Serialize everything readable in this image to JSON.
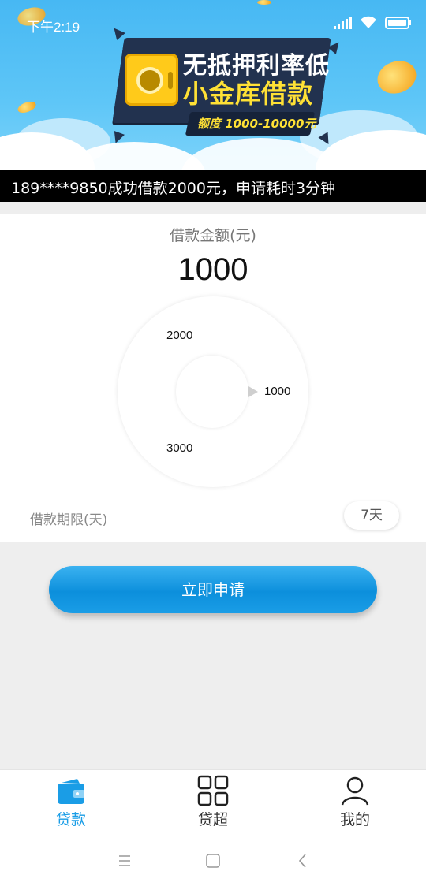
{
  "status_bar": {
    "time": "下午2:19",
    "icons": [
      "signal-icon",
      "wifi-icon",
      "battery-icon"
    ]
  },
  "banner": {
    "headline": "无抵押利率低",
    "subheadline": "小金库借款",
    "quota": "额度 1000-10000元",
    "colors": {
      "sky": "#47b8f3",
      "board": "#22324f",
      "accent": "#ffe135"
    }
  },
  "marquee": {
    "text": "189****9850成功借款2000元，申请耗时3分钟"
  },
  "loan": {
    "amount_label": "借款金额(元)",
    "amount_value": "1000",
    "dial_options": {
      "top": "2000",
      "right": "1000",
      "bottom": "3000"
    },
    "term_label": "借款期限(天)",
    "term_value": "7天"
  },
  "apply_button": {
    "label": "立即申请",
    "color": "#0c8fdc"
  },
  "bottom_nav": {
    "active_color": "#1a9de6",
    "items": [
      {
        "label": "贷款",
        "icon": "wallet-icon",
        "active": true
      },
      {
        "label": "贷超",
        "icon": "grid-icon",
        "active": false
      },
      {
        "label": "我的",
        "icon": "person-icon",
        "active": false
      }
    ]
  },
  "system_nav": {
    "buttons": [
      "menu-icon",
      "home-icon",
      "back-icon"
    ]
  }
}
